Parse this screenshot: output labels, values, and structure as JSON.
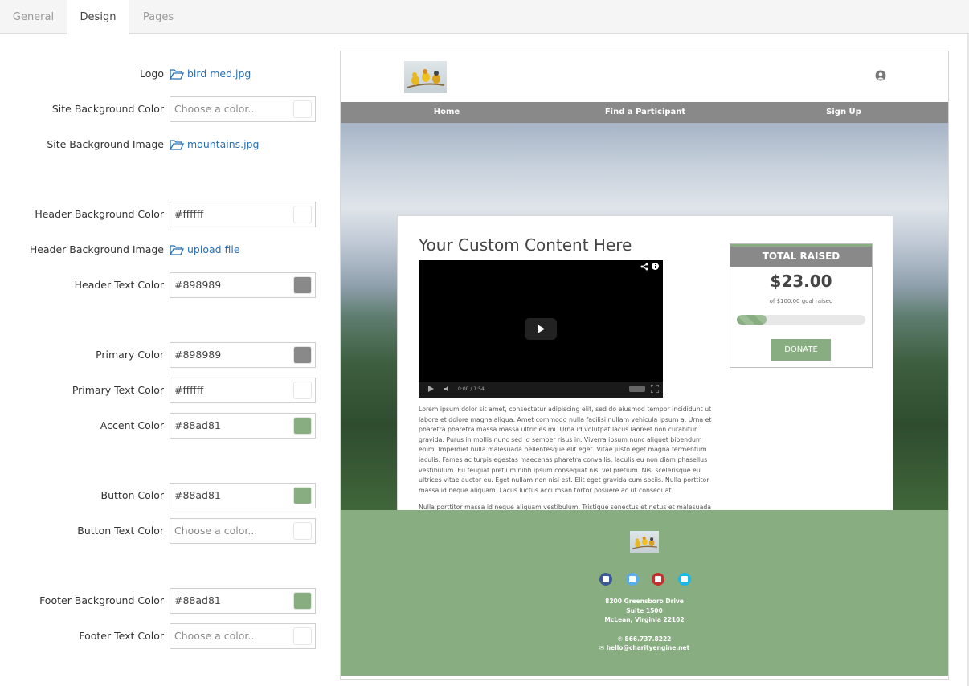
{
  "tabs": [
    {
      "label": "General",
      "active": false
    },
    {
      "label": "Design",
      "active": true
    },
    {
      "label": "Pages",
      "active": false
    }
  ],
  "form": {
    "logo": {
      "label": "Logo",
      "file": "bird med.jpg"
    },
    "site_bg_color": {
      "label": "Site Background Color",
      "placeholder": "Choose a color...",
      "value": ""
    },
    "site_bg_image": {
      "label": "Site Background Image",
      "file": "mountains.jpg"
    },
    "header_bg_color": {
      "label": "Header Background Color",
      "value": "#ffffff",
      "swatch": "#ffffff"
    },
    "header_bg_image": {
      "label": "Header Background Image",
      "file": "upload file"
    },
    "header_text_color": {
      "label": "Header Text Color",
      "value": "#898989",
      "swatch": "#898989"
    },
    "primary_color": {
      "label": "Primary Color",
      "value": "#898989",
      "swatch": "#898989"
    },
    "primary_text_color": {
      "label": "Primary Text Color",
      "value": "#ffffff",
      "swatch": "#ffffff"
    },
    "accent_color": {
      "label": "Accent Color",
      "value": "#88ad81",
      "swatch": "#88ad81"
    },
    "button_color": {
      "label": "Button Color",
      "value": "#88ad81",
      "swatch": "#88ad81"
    },
    "button_text_color": {
      "label": "Button Text Color",
      "placeholder": "Choose a color...",
      "value": ""
    },
    "footer_bg_color": {
      "label": "Footer Background Color",
      "value": "#88ad81",
      "swatch": "#88ad81"
    },
    "footer_text_color": {
      "label": "Footer Text Color",
      "placeholder": "Choose a color...",
      "value": ""
    }
  },
  "preview": {
    "nav": [
      "Home",
      "Find a Participant",
      "Sign Up"
    ],
    "content_title": "Your Custom Content Here",
    "video_time": "0:00 / 1:54",
    "paragraph1": "Lorem ipsum dolor sit amet, consectetur adipiscing elit, sed do eiusmod tempor incididunt ut labore et dolore magna aliqua. Amet commodo nulla facilisi nullam vehicula ipsum a. Urna et pharetra pharetra massa massa ultricies mi. Urna id volutpat lacus laoreet non curabitur gravida. Purus in mollis nunc sed id semper risus in. Viverra ipsum nunc aliquet bibendum enim. Imperdiet nulla malesuada pellentesque elit eget. Vitae justo eget magna fermentum iaculis. Fames ac turpis egestas maecenas pharetra convallis. Iaculis eu non diam phasellus vestibulum. Eu feugiat pretium nibh ipsum consequat nisl vel pretium. Nisi scelerisque eu ultrices vitae auctor eu. Eget nullam non nisi est. Elit eget gravida cum sociis. Nulla porttitor massa id neque aliquam. Lacus luctus accumsan tortor posuere ac ut consequat.",
    "paragraph2": "Nulla porttitor massa id neque aliquam vestibulum. Tristique senectus et netus et malesuada fames. Fermentum leo vel orci porta non pulvinar neque laoreet. Risus nullam eget felis eget nunc lobortis mattis.",
    "raised": {
      "title": "TOTAL RAISED",
      "amount": "$23.00",
      "goal": "of $100.00 goal raised",
      "progress_fraction": 0.23,
      "donate": "DONATE"
    },
    "footer": {
      "address1": "8200 Greensboro Drive",
      "address2": "Suite 1500",
      "address3": "McLean, Virginia 22102",
      "phone": "866.737.8222",
      "email": "hello@charityengine.net",
      "social": [
        {
          "icon": "facebook-icon",
          "color": "#3b5998"
        },
        {
          "icon": "twitter-icon",
          "color": "#55acee"
        },
        {
          "icon": "youtube-icon",
          "color": "#c4302b"
        },
        {
          "icon": "vimeo-icon",
          "color": "#1ab7ea"
        }
      ]
    }
  }
}
